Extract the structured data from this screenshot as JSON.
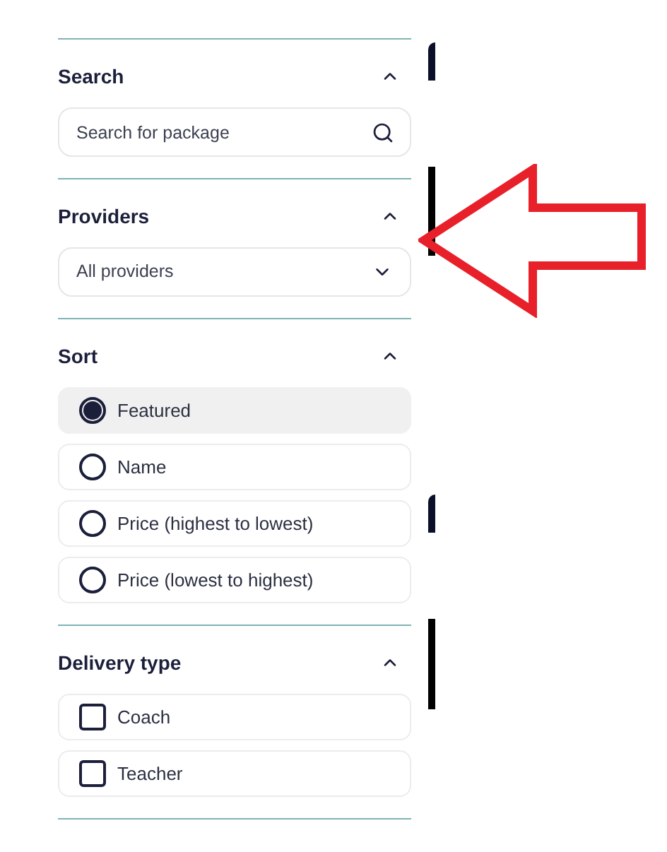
{
  "sections": [
    {
      "kind": "search",
      "title": "Search",
      "expanded": true,
      "placeholder": "Search for package"
    },
    {
      "kind": "select",
      "title": "Providers",
      "expanded": true,
      "value": "All providers"
    },
    {
      "kind": "radio",
      "title": "Sort",
      "expanded": true,
      "options": [
        {
          "label": "Featured",
          "selected": true
        },
        {
          "label": "Name",
          "selected": false
        },
        {
          "label": "Price (highest to lowest)",
          "selected": false
        },
        {
          "label": "Price (lowest to highest)",
          "selected": false
        }
      ]
    },
    {
      "kind": "checkbox",
      "title": "Delivery type",
      "expanded": true,
      "options": [
        {
          "label": "Coach",
          "checked": false
        },
        {
          "label": "Teacher",
          "checked": false
        }
      ]
    }
  ]
}
